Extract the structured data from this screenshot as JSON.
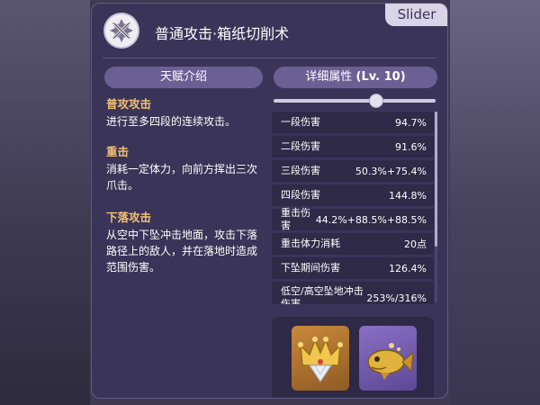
{
  "page": {
    "slider_tag": "Slider"
  },
  "header": {
    "title": "普通攻击·箱纸切削术",
    "icon": "crossed-swords-icon"
  },
  "tabs": {
    "talent_intro": "天赋介绍",
    "detail_prefix": "详细属性 ",
    "detail_level": "(Lv. 10)"
  },
  "level_slider": {
    "value": 10
  },
  "skills": [
    {
      "name": "普攻攻击",
      "desc": "进行至多四段的连续攻击。"
    },
    {
      "name": "重击",
      "desc": "消耗一定体力，向前方挥出三次爪击。"
    },
    {
      "name": "下落攻击",
      "desc": "从空中下坠冲击地面，攻击下落路径上的敌人，并在落地时造成范围伤害。"
    }
  ],
  "stats": [
    {
      "label": "一段伤害",
      "value": "94.7%"
    },
    {
      "label": "二段伤害",
      "value": "91.6%"
    },
    {
      "label": "三段伤害",
      "value": "50.3%+75.4%"
    },
    {
      "label": "四段伤害",
      "value": "144.8%"
    },
    {
      "label": "重击伤害",
      "value": "44.2%+88.5%+88.5%"
    },
    {
      "label": "重击体力消耗",
      "value": "20点"
    },
    {
      "label": "下坠期间伤害",
      "value": "126.4%"
    },
    {
      "label": "低空/高空坠地冲击\n伤害",
      "value": "253%/316%"
    }
  ],
  "materials": [
    {
      "icon": "crown-icon"
    },
    {
      "icon": "golden-fish-icon"
    }
  ],
  "colors": {
    "accent_gold": "#f2c073",
    "panel": "#3a3458",
    "pill": "#6a6094"
  }
}
